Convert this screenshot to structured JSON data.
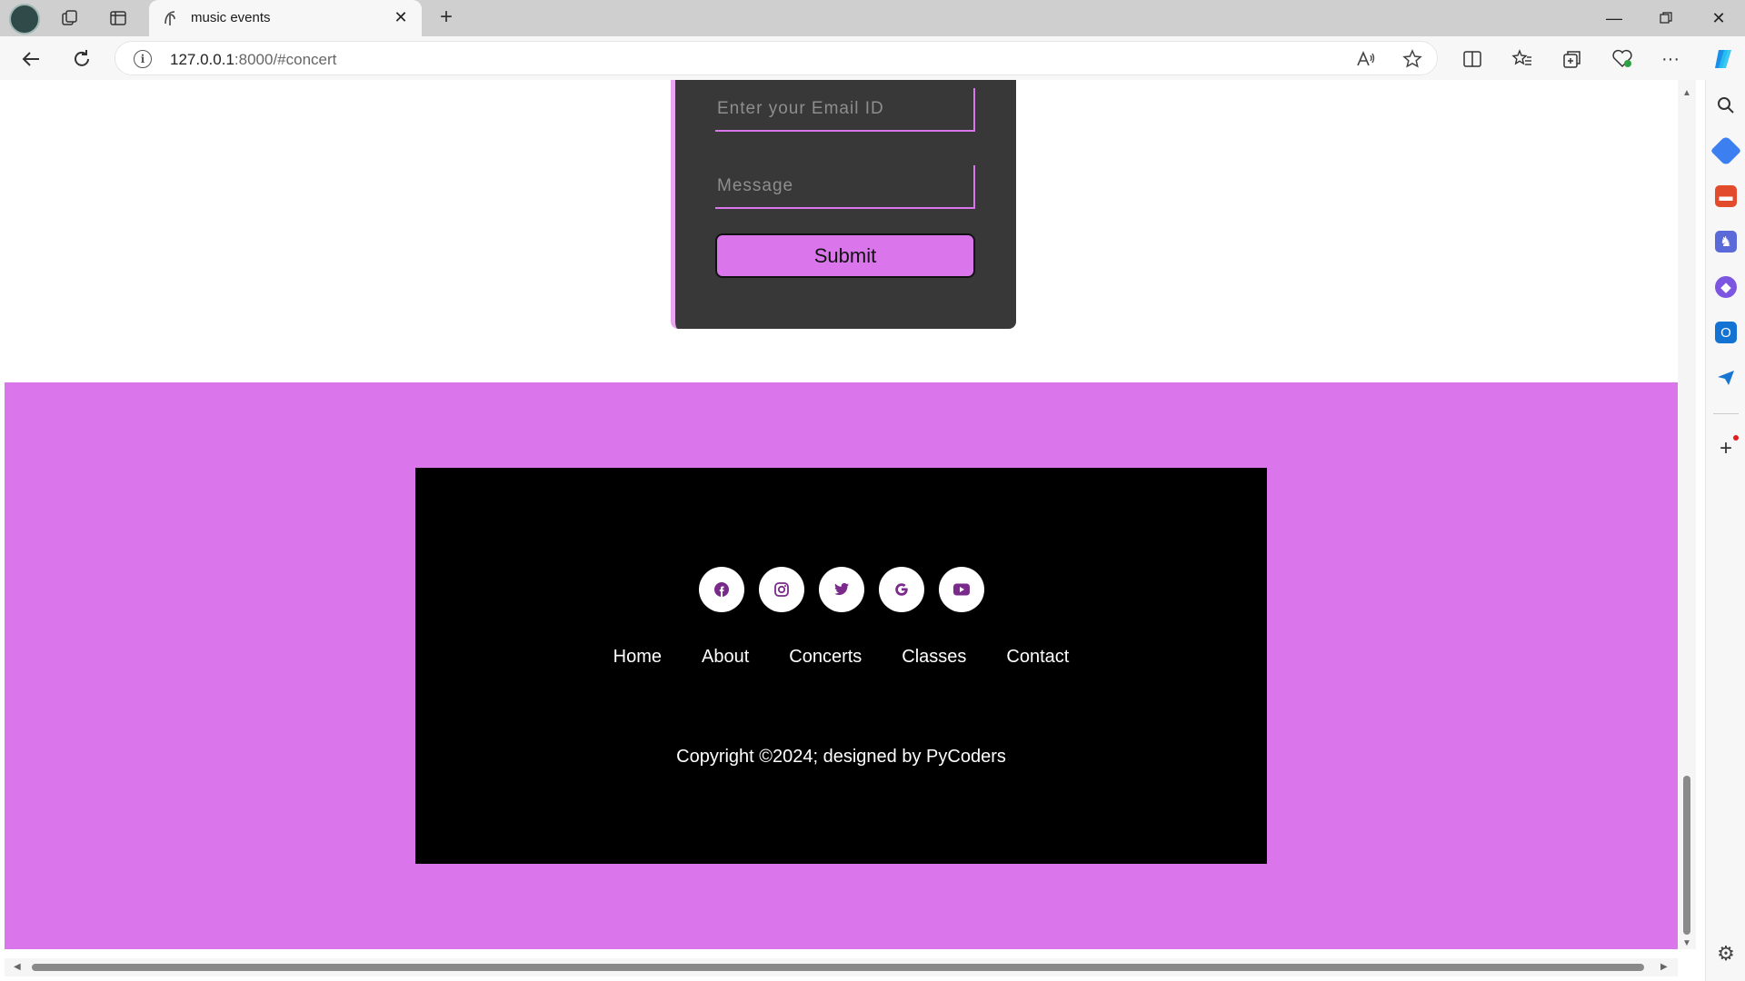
{
  "browser": {
    "tab_title": "music events",
    "url_host": "127.0.0.1",
    "url_rest": ":8000/#concert",
    "window_controls": [
      "minimize",
      "restore",
      "close"
    ]
  },
  "form": {
    "email_placeholder": "Enter your Email ID",
    "message_placeholder": "Message",
    "submit_label": "Submit"
  },
  "footer": {
    "socials": [
      "facebook-icon",
      "instagram-icon",
      "twitter-icon",
      "google-icon",
      "youtube-icon"
    ],
    "nav": [
      "Home",
      "About",
      "Concerts",
      "Classes",
      "Contact"
    ],
    "copyright": "Copyright ©2024; designed by PyCoders"
  },
  "colors": {
    "accent": "#da75ec",
    "footer_box": "#000000",
    "form_card": "#383838"
  }
}
